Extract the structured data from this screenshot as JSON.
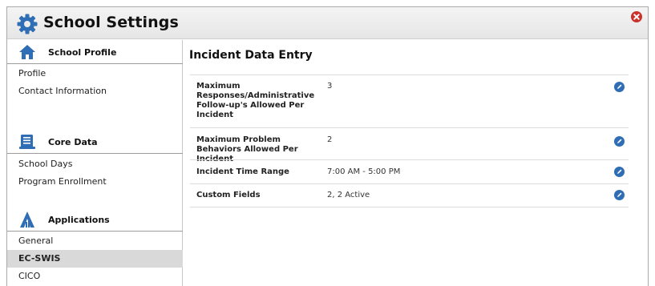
{
  "header": {
    "title": "School Settings"
  },
  "sidebar": {
    "sections": [
      {
        "label": "School Profile",
        "icon": "home-icon",
        "items": [
          "Profile",
          "Contact Information"
        ]
      },
      {
        "label": "Core Data",
        "icon": "document-icon",
        "items": [
          "School Days",
          "Program Enrollment"
        ]
      },
      {
        "label": "Applications",
        "icon": "applications-icon",
        "items": [
          "General",
          "EC-SWIS",
          "CICO"
        ]
      }
    ],
    "active_item": "EC-SWIS"
  },
  "main": {
    "title": "Incident Data Entry",
    "rows": [
      {
        "label": "Maximum Responses/Administrative Follow-up's Allowed Per Incident",
        "value": "3"
      },
      {
        "label": "Maximum Problem Behaviors Allowed Per Incident",
        "value": "2"
      },
      {
        "label": "Incident Time Range",
        "value": "7:00 AM - 5:00 PM"
      },
      {
        "label": "Custom Fields",
        "value": "2, 2 Active"
      }
    ]
  },
  "colors": {
    "accent_blue": "#2f6db5",
    "close_red": "#c9322b",
    "active_row": "#d9d9d9",
    "header_bg": "#ececec"
  }
}
